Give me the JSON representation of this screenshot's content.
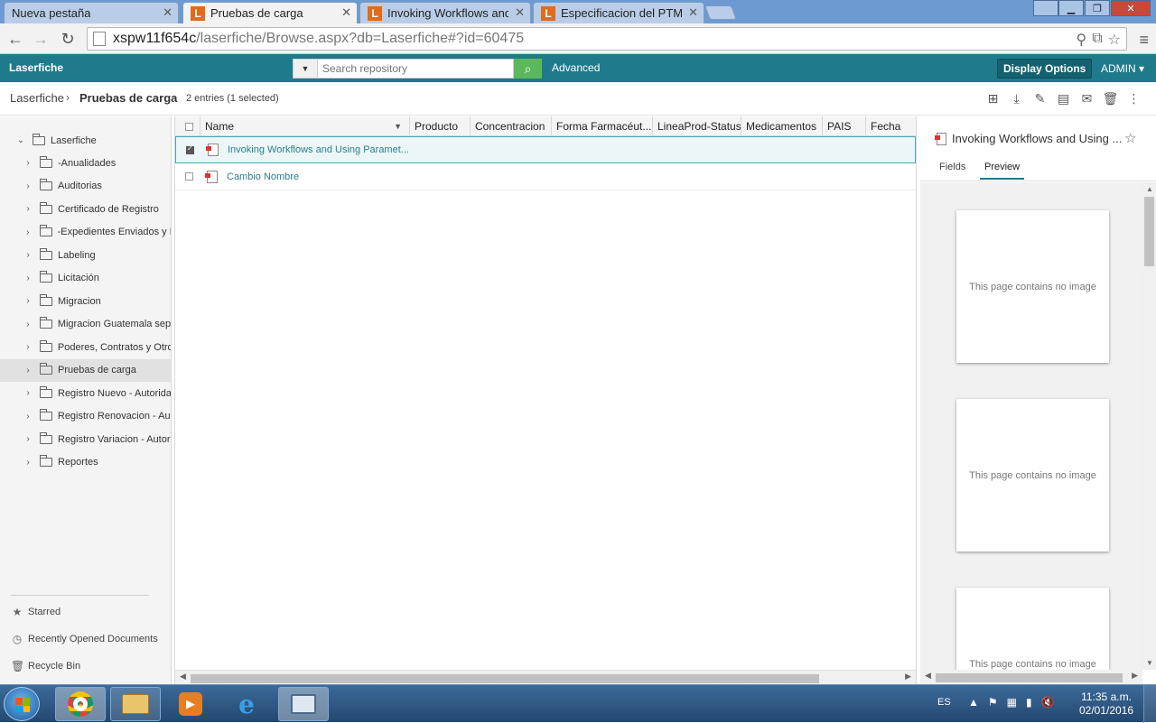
{
  "browser": {
    "tabs": [
      {
        "title": "Nueva pestaña",
        "favicon": "",
        "active": false
      },
      {
        "title": "Pruebas de carga",
        "favicon": "L",
        "active": true
      },
      {
        "title": "Invoking Workflows and U",
        "favicon": "L",
        "active": false
      },
      {
        "title": "Especificacion del PTMéxi",
        "favicon": "L",
        "active": false
      }
    ],
    "url_host": "xspw11f654c",
    "url_path": "/laserfiche/Browse.aspx?db=Laserfiche#?id=60475"
  },
  "header": {
    "logo": "Laserfiche",
    "search_placeholder": "Search repository",
    "advanced_label": "Advanced",
    "display_options_label": "Display Options",
    "user_label": "ADMIN",
    "accent_color": "#1f7a8c"
  },
  "breadcrumb": {
    "root": "Laserfiche",
    "current": "Pruebas de carga",
    "entries_text": "2 entries (1 selected)"
  },
  "tree": {
    "root": "Laserfiche",
    "items": [
      {
        "label": "-Anualidades",
        "selected": false
      },
      {
        "label": "Auditorias",
        "selected": false
      },
      {
        "label": "Certificado de Registro",
        "selected": false
      },
      {
        "label": "-Expedientes Enviados y R",
        "selected": false
      },
      {
        "label": "Labeling",
        "selected": false
      },
      {
        "label": "Licitación",
        "selected": false
      },
      {
        "label": "Migracion",
        "selected": false
      },
      {
        "label": "Migracion Guatemala sep.",
        "selected": false
      },
      {
        "label": "Poderes, Contratos y Otro",
        "selected": false
      },
      {
        "label": "Pruebas de carga",
        "selected": true
      },
      {
        "label": "Registro Nuevo - Autorida",
        "selected": false
      },
      {
        "label": "Registro Renovacion - Aut",
        "selected": false
      },
      {
        "label": "Registro Variacion - Autor",
        "selected": false
      },
      {
        "label": "Reportes",
        "selected": false
      }
    ],
    "links": {
      "starred": "Starred",
      "recent": "Recently Opened Documents",
      "recycle": "Recycle Bin"
    }
  },
  "list": {
    "columns": [
      "Name",
      "Producto",
      "Concentracion",
      "Forma Farmacéut...",
      "LineaProd-Status",
      "Medicamentos",
      "PAIS",
      "Fecha"
    ],
    "rows": [
      {
        "name": "Invoking Workflows and Using Paramet...",
        "selected": true
      },
      {
        "name": "Cambio Nombre",
        "selected": false
      }
    ]
  },
  "preview": {
    "title": "Invoking Workflows and Using ...",
    "tabs": [
      "Fields",
      "Preview"
    ],
    "active_tab": "Preview",
    "pages": [
      "This page contains no image",
      "This page contains no image",
      "This page contains no image"
    ]
  },
  "taskbar": {
    "lang": "ES",
    "time": "11:35 a.m.",
    "date": "02/01/2016"
  }
}
